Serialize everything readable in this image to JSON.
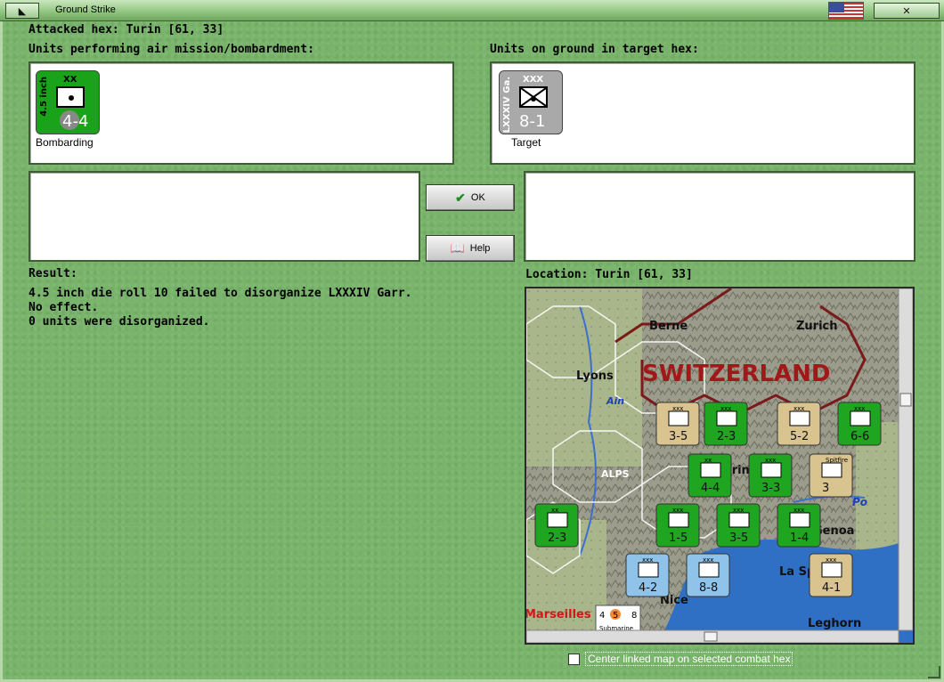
{
  "window": {
    "title": "Ground Strike",
    "left_button_icon": "◣",
    "right_button_icon": "✕"
  },
  "header": {
    "attacked_hex": "Attacked hex: Turin  [61, 33]",
    "air_units_label": "Units performing air mission/bombardment:",
    "ground_units_label": "Units on ground in target hex:"
  },
  "attacker": {
    "name": "4.5 inch",
    "size": "XX",
    "strength": "4-4",
    "caption": "Bombarding",
    "color": "#1aa31a"
  },
  "defender": {
    "name": "LXXXIV Ga.",
    "size": "XXX",
    "strength": "8-1",
    "caption": "Target",
    "color": "#a9a9a9"
  },
  "buttons": {
    "ok": "OK",
    "help": "Help"
  },
  "result": {
    "label": "Result:",
    "lines": [
      "4.5 inch die roll 10 failed to disorganize LXXXIV Garr.",
      "No effect.",
      "0 units were disorganized."
    ]
  },
  "location": {
    "label": "Location:  Turin  [61, 33]"
  },
  "map": {
    "country_label": "SWITZERLAND",
    "place_names": [
      "Berne",
      "Zurich",
      "Lyons",
      "Ain",
      "ALPS",
      "Turin",
      "Po",
      "Genoa",
      "Nice",
      "La Spezia",
      "Leghorn",
      "Marseilles"
    ],
    "counters": [
      {
        "label": "xxx",
        "strength": "3-5",
        "color": "#d9c48f"
      },
      {
        "label": "xxx",
        "strength": "2-3",
        "color": "#1fa51f"
      },
      {
        "label": "xxx",
        "strength": "5-2",
        "color": "#d9c48f"
      },
      {
        "label": "xxx",
        "strength": "6-6",
        "color": "#1fa51f"
      },
      {
        "label": "xx",
        "strength": "4-4",
        "color": "#1fa51f"
      },
      {
        "label": "xxx",
        "strength": "3-3",
        "color": "#1fa51f"
      },
      {
        "label": "Spitfire",
        "strength": "3",
        "color": "#d9c48f"
      },
      {
        "label": "xx",
        "strength": "2-3",
        "color": "#1fa51f"
      },
      {
        "label": "xxx",
        "strength": "1-5",
        "color": "#1fa51f"
      },
      {
        "label": "xxx",
        "strength": "3-5",
        "color": "#1fa51f"
      },
      {
        "label": "xxx",
        "strength": "1-4",
        "color": "#1fa51f"
      },
      {
        "label": "xxx",
        "strength": "4-2",
        "color": "#8fc3ea"
      },
      {
        "label": "xxx",
        "strength": "8-8",
        "color": "#8fc3ea"
      },
      {
        "label": "xxx",
        "strength": "4-1",
        "color": "#d9c48f"
      }
    ],
    "submarine_label": "Submarine",
    "submarine_values": [
      "4",
      "5",
      "8"
    ]
  },
  "options": {
    "center_linked_map": "Center linked map on selected combat hex",
    "center_linked_map_checked": false
  }
}
